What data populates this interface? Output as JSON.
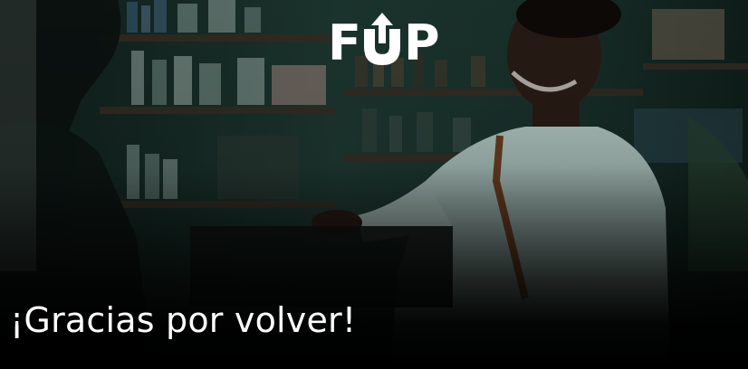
{
  "hero": {
    "title": "¡Gracias por volver!",
    "image_icon": "photo-shopkeeper"
  },
  "brand": {
    "logo_text_left": "F",
    "logo_text_right": "P",
    "logo_arrow_icon": "up-arrow-u-icon",
    "logo_color": "#ffffff"
  },
  "colors": {
    "overlay": "#000000",
    "photo_tint": "#16302a",
    "title_text": "#ffffff"
  }
}
